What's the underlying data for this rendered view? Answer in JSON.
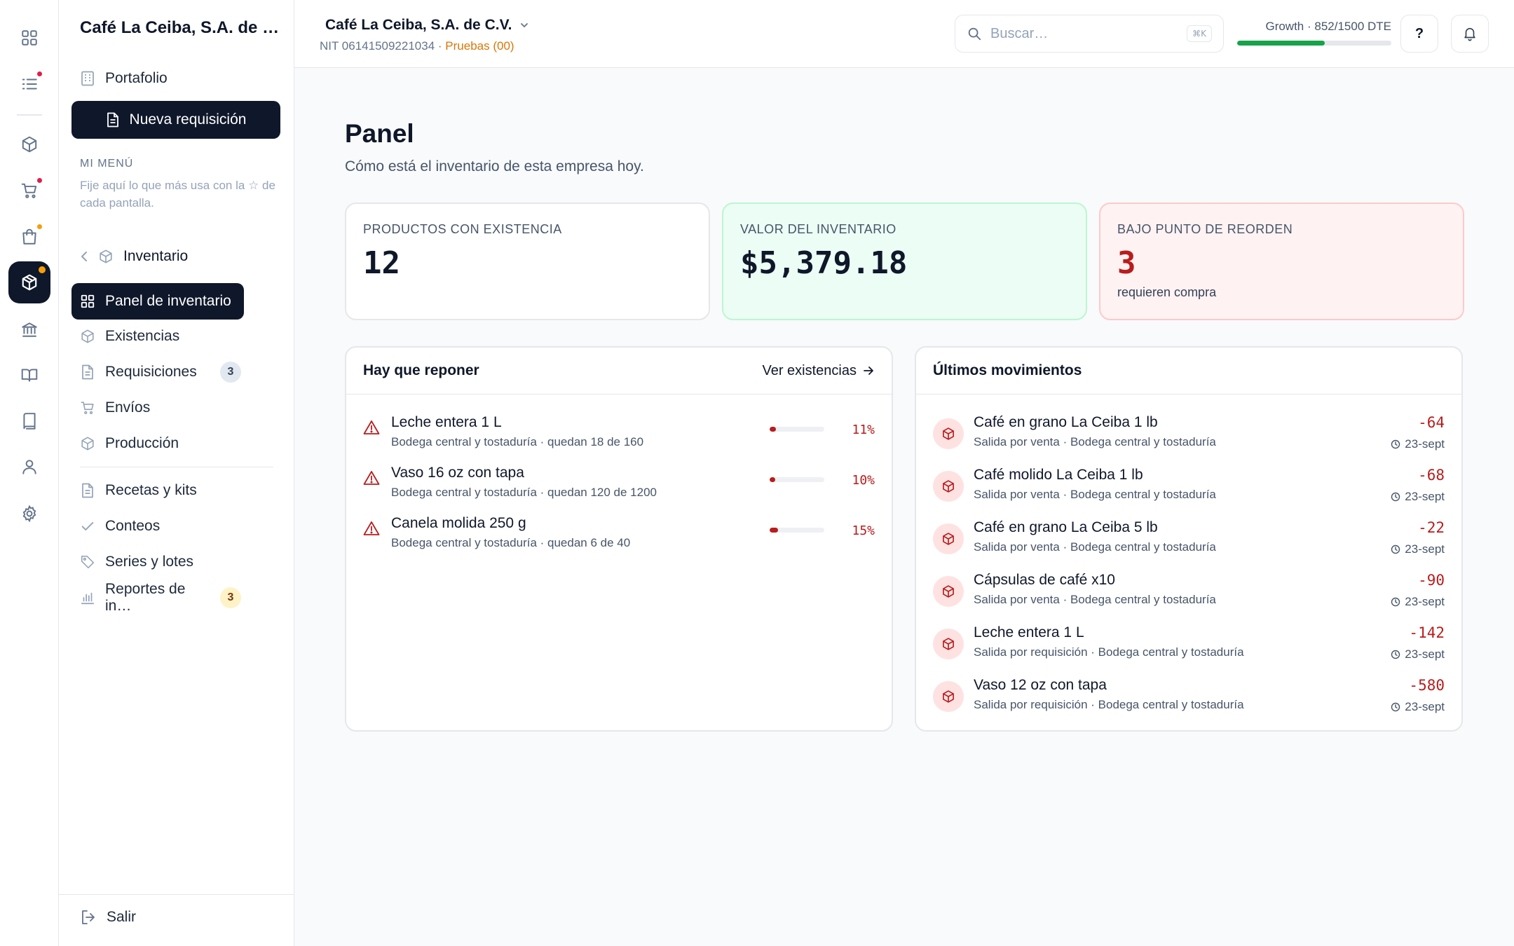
{
  "rail": {
    "items": [
      {
        "icon": "grid-icon"
      },
      {
        "icon": "list-icon",
        "dot": "#e11d48"
      },
      {
        "icon": "cube-icon"
      },
      {
        "icon": "cart-icon",
        "dot": "#e11d48"
      },
      {
        "icon": "bag-icon",
        "dot": "#f59e0b"
      },
      {
        "icon": "inventory-icon",
        "dot": "#f59e0b",
        "active": true
      },
      {
        "icon": "bank-icon"
      },
      {
        "icon": "book-open-icon"
      },
      {
        "icon": "book-icon"
      },
      {
        "icon": "user-icon"
      },
      {
        "icon": "gear-icon"
      }
    ]
  },
  "sidebar": {
    "company": "Café La Ceiba, S.A. de …",
    "portfolio_label": "Portafolio",
    "new_req_label": "Nueva requisición",
    "menu_title": "MI MENÚ",
    "menu_hint": "Fije aquí lo que más usa con la ☆ de cada pantalla.",
    "section_label": "Inventario",
    "items": [
      {
        "label": "Panel de inventario",
        "active": true
      },
      {
        "label": "Existencias"
      },
      {
        "label": "Requisiciones",
        "badge": "3"
      },
      {
        "label": "Envíos"
      },
      {
        "label": "Producción"
      },
      {
        "label": "Recetas y kits"
      },
      {
        "label": "Conteos"
      },
      {
        "label": "Series y lotes"
      },
      {
        "label": "Reportes de in…",
        "badge": "3"
      }
    ],
    "logout_label": "Salir"
  },
  "header": {
    "company": "Café La Ceiba, S.A. de C.V.",
    "nit": "NIT 06141509221034 · ",
    "env": "Pruebas (00)",
    "search_placeholder": "Buscar…",
    "search_kbd": "⌘K",
    "plan_label": "Growth · 852/1500 DTE",
    "plan_fraction": 0.568,
    "help_label": "?"
  },
  "main": {
    "title": "Panel",
    "subtitle": "Cómo está el inventario de esta empresa hoy.",
    "kpis": [
      {
        "label": "PRODUCTOS CON EXISTENCIA",
        "value": "12"
      },
      {
        "label": "VALOR DEL INVENTARIO",
        "value": "$5,379.18"
      },
      {
        "label": "BAJO PUNTO DE REORDEN",
        "value": "3",
        "note": "requieren compra"
      }
    ],
    "reorder": {
      "title": "Hay que reponer",
      "link": "Ver existencias",
      "rows": [
        {
          "name": "Leche entera 1 L",
          "meta": "Bodega central y tostaduría · quedan 18 de 160",
          "pct": "11%",
          "level": 0.11
        },
        {
          "name": "Vaso 16 oz con tapa",
          "meta": "Bodega central y tostaduría · quedan 120 de 1200",
          "pct": "10%",
          "level": 0.1
        },
        {
          "name": "Canela molida 250 g",
          "meta": "Bodega central y tostaduría · quedan 6 de 40",
          "pct": "15%",
          "level": 0.15
        }
      ]
    },
    "movements": {
      "title": "Últimos movimientos",
      "rows": [
        {
          "name": "Café en grano La Ceiba 1 lb",
          "meta": "Salida por venta · Bodega central y tostaduría",
          "qty": "-64",
          "date": "23-sept"
        },
        {
          "name": "Café molido La Ceiba 1 lb",
          "meta": "Salida por venta · Bodega central y tostaduría",
          "qty": "-68",
          "date": "23-sept"
        },
        {
          "name": "Café en grano La Ceiba 5 lb",
          "meta": "Salida por venta · Bodega central y tostaduría",
          "qty": "-22",
          "date": "23-sept"
        },
        {
          "name": "Cápsulas de café x10",
          "meta": "Salida por venta · Bodega central y tostaduría",
          "qty": "-90",
          "date": "23-sept"
        },
        {
          "name": "Leche entera 1 L",
          "meta": "Salida por requisición · Bodega central y tostaduría",
          "qty": "-142",
          "date": "23-sept"
        },
        {
          "name": "Vaso 12 oz con tapa",
          "meta": "Salida por requisición · Bodega central y tostaduría",
          "qty": "-580",
          "date": "23-sept"
        }
      ]
    }
  }
}
